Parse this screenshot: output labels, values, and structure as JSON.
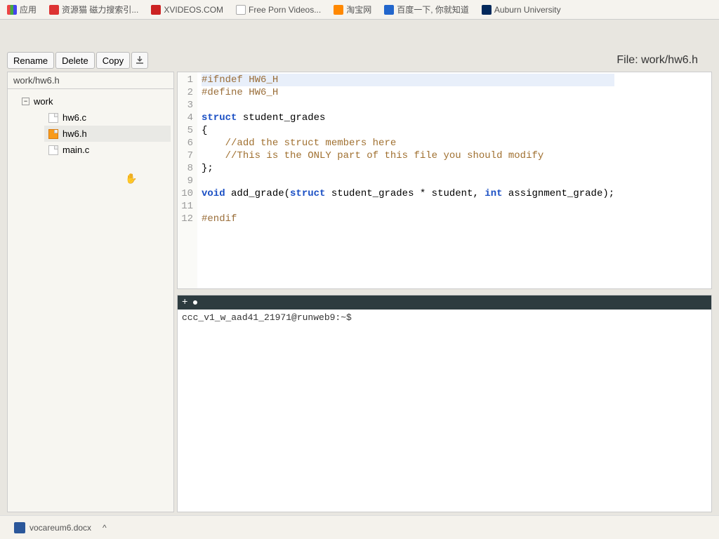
{
  "bookmarks": [
    {
      "label": "应用"
    },
    {
      "label": "资源猫 磁力搜索引..."
    },
    {
      "label": "XVIDEOS.COM"
    },
    {
      "label": "Free Porn Videos..."
    },
    {
      "label": "淘宝网"
    },
    {
      "label": "百度一下, 你就知道"
    },
    {
      "label": "Auburn University"
    }
  ],
  "toolbar": {
    "rename": "Rename",
    "delete": "Delete",
    "copy": "Copy",
    "file_label_prefix": "File: ",
    "file_label_path": "work/hw6.h"
  },
  "sidebar": {
    "header": "work/hw6.h",
    "folder": "work",
    "files": [
      {
        "name": "hw6.c"
      },
      {
        "name": "hw6.h"
      },
      {
        "name": "main.c"
      }
    ]
  },
  "code": {
    "lines": [
      {
        "n": 1,
        "hl": true,
        "html": "<span class='pp'>#ifndef HW6_H</span>"
      },
      {
        "n": 2,
        "html": "<span class='pp'>#define HW6_H</span>"
      },
      {
        "n": 3,
        "html": ""
      },
      {
        "n": 4,
        "html": "<span class='kw'>struct</span> student_grades"
      },
      {
        "n": 5,
        "html": "{"
      },
      {
        "n": 6,
        "html": "    <span class='cm'>//add the struct members here</span>"
      },
      {
        "n": 7,
        "html": "    <span class='cm'>//This is the ONLY part of this file you should modify</span>"
      },
      {
        "n": 8,
        "html": "};"
      },
      {
        "n": 9,
        "html": ""
      },
      {
        "n": 10,
        "html": "<span class='kw'>void</span> add_grade(<span class='kw'>struct</span> student_grades * student, <span class='kw'>int</span> assignment_grade);"
      },
      {
        "n": 11,
        "html": ""
      },
      {
        "n": 12,
        "html": "<span class='pp'>#endif</span>"
      }
    ]
  },
  "terminal": {
    "prompt": "ccc_v1_w_aad41_21971@runweb9:~$"
  },
  "taskbar": {
    "doc": "vocareum6.docx"
  }
}
